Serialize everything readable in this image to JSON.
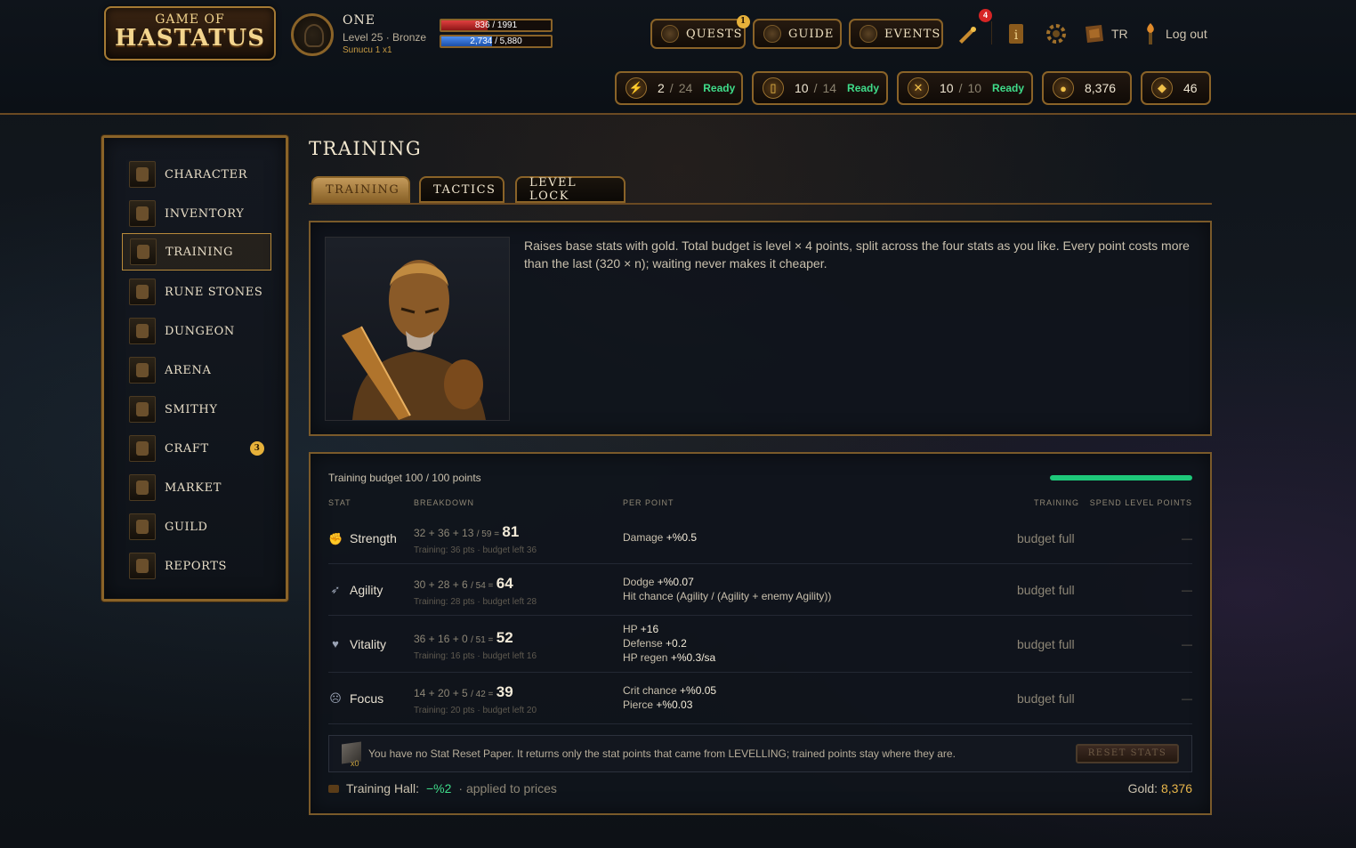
{
  "logo": {
    "line1": "GAME OF",
    "line2": "HASTATUS"
  },
  "player": {
    "name": "ONE",
    "level_line": "Level 25 · Bronze",
    "class_line": "Sunucu 1 x1",
    "hp_text": "836 / 1991",
    "hp_fraction": 0.42,
    "xp_text": "2,734 / 5,880",
    "xp_fraction": 0.465
  },
  "nav": {
    "quests": "QUESTS",
    "quests_badge": "1",
    "guide": "GUIDE",
    "events": "EVENTS",
    "notifications_badge": "4",
    "language": "TR",
    "logout": "Log out"
  },
  "resources": [
    {
      "icon": "lightning-icon",
      "current": "2",
      "max": "24",
      "status": "Ready"
    },
    {
      "icon": "door-icon",
      "current": "10",
      "max": "14",
      "status": "Ready"
    },
    {
      "icon": "crossed-swords-icon",
      "current": "10",
      "max": "10",
      "status": "Ready"
    }
  ],
  "gold": "8,376",
  "gems": "46",
  "sidebar": {
    "items": [
      {
        "label": "CHARACTER",
        "icon": "helmet-icon"
      },
      {
        "label": "INVENTORY",
        "icon": "chest-icon"
      },
      {
        "label": "TRAINING",
        "icon": "dumbbell-icon"
      },
      {
        "label": "RUNE STONES",
        "icon": "rune-stone-icon"
      },
      {
        "label": "DUNGEON",
        "icon": "dungeon-gate-icon"
      },
      {
        "label": "ARENA",
        "icon": "crossed-swords-icon"
      },
      {
        "label": "SMITHY",
        "icon": "hammer-icon"
      },
      {
        "label": "CRAFT",
        "icon": "mortar-icon",
        "badge": "3"
      },
      {
        "label": "MARKET",
        "icon": "market-stall-icon"
      },
      {
        "label": "GUILD",
        "icon": "banner-icon"
      },
      {
        "label": "REPORTS",
        "icon": "scroll-icon"
      }
    ]
  },
  "page": {
    "title": "TRAINING",
    "tabs": [
      "TRAINING",
      "TACTICS",
      "LEVEL LOCK"
    ],
    "description": "Raises base stats with gold. Total budget is level × 4 points, split across the four stats as you like. Every point costs more than the last (320 × n); waiting never makes it cheaper."
  },
  "training": {
    "budget_label": "Training budget 100 / 100 points",
    "budget_fraction": 1.0,
    "columns": {
      "stat": "STAT",
      "breakdown": "BREAKDOWN",
      "per_point": "PER POINT",
      "training": "TRAINING",
      "spend": "SPEND LEVEL POINTS"
    },
    "stats": [
      {
        "name": "Strength",
        "breakdown": "32 + 36 + 13",
        "cap": "/ 59 =",
        "total": "81",
        "sub": "Training: 36 pts · budget left 36",
        "per_point": [
          [
            "Damage",
            "+%0.5"
          ]
        ],
        "training": "budget full",
        "spend": "—"
      },
      {
        "name": "Agility",
        "breakdown": "30 + 28 + 6",
        "cap": "/ 54 =",
        "total": "64",
        "sub": "Training: 28 pts · budget left 28",
        "per_point": [
          [
            "Dodge",
            "+%0.07"
          ],
          [
            "Hit chance (Agility / (Agility + enemy Agility))",
            ""
          ]
        ],
        "training": "budget full",
        "spend": "—"
      },
      {
        "name": "Vitality",
        "breakdown": "36 + 16 + 0",
        "cap": "/ 51 =",
        "total": "52",
        "sub": "Training: 16 pts · budget left 16",
        "per_point": [
          [
            "HP",
            "+16"
          ],
          [
            "Defense",
            "+0.2"
          ],
          [
            "HP regen",
            "+%0.3/sa"
          ]
        ],
        "training": "budget full",
        "spend": "—"
      },
      {
        "name": "Focus",
        "breakdown": "14 + 20 + 5",
        "cap": "/ 42 =",
        "total": "39",
        "sub": "Training: 20 pts · budget left 20",
        "per_point": [
          [
            "Crit chance",
            "+%0.05"
          ],
          [
            "Pierce",
            "+%0.03"
          ]
        ],
        "training": "budget full",
        "spend": "—"
      }
    ],
    "reset": {
      "count": "x0",
      "text": "You have no Stat Reset Paper. It returns only the stat points that came from LEVELLING; trained points stay where they are.",
      "button": "RESET STATS"
    },
    "hall": {
      "label": "Training Hall:",
      "discount": "−%2",
      "suffix": "· applied to prices"
    },
    "gold_label": "Gold:",
    "gold": "8,376"
  }
}
